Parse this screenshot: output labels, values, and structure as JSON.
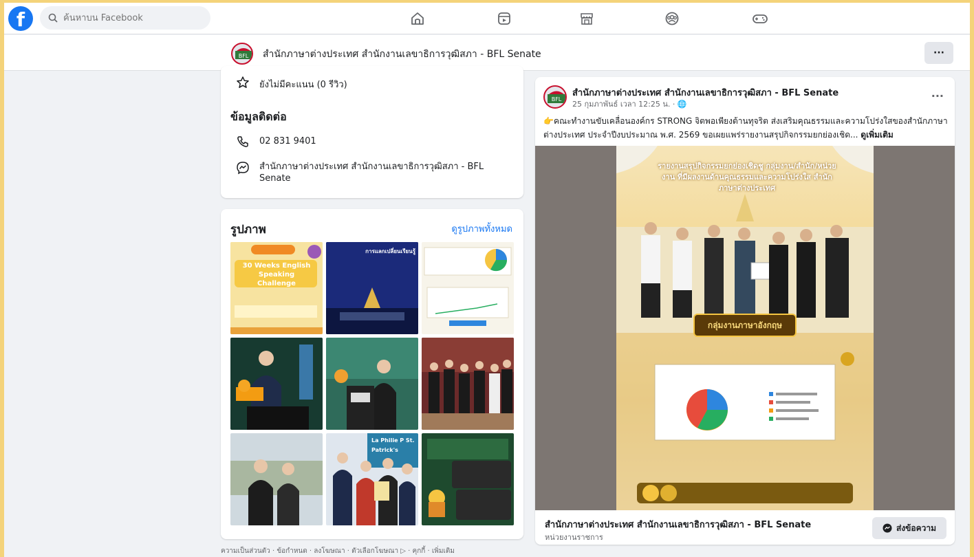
{
  "search": {
    "placeholder": "ค้นหาบน Facebook"
  },
  "nav": {
    "icons": [
      "home-icon",
      "video-icon",
      "marketplace-icon",
      "groups-icon",
      "gaming-icon"
    ]
  },
  "page_header": {
    "title": "สำนักภาษาต่างประเทศ สำนักงานเลขาธิการวุฒิสภา - BFL Senate",
    "more_label": "···"
  },
  "info": {
    "rating_text": "ยังไม่มีคะแนน (0 รีวิว)",
    "contact_title": "ข้อมูลติดต่อ",
    "phone": "02 831 9401",
    "messenger_name": "สำนักภาษาต่างประเทศ สำนักงานเลขาธิการวุฒิสภา - BFL Senate"
  },
  "photos": {
    "title": "รูปภาพ",
    "see_all": "ดูรูปภาพทั้งหมด",
    "tiles": [
      {
        "caption": "30 Weeks English Speaking Challenge",
        "bg": "#f7e3a0"
      },
      {
        "caption": "การแลกเปลี่ยนเรียนรู้",
        "bg": "#1b2a7a"
      },
      {
        "caption": "",
        "bg": "#f7f4ea"
      },
      {
        "caption": "",
        "bg": "#1f4b3a"
      },
      {
        "caption": "",
        "bg": "#2f6b5a"
      },
      {
        "caption": "",
        "bg": "#6b2a2a"
      },
      {
        "caption": "",
        "bg": "#cfd9df"
      },
      {
        "caption": "La Philie P St. Patrick's",
        "bg": "#dfe6ee"
      },
      {
        "caption": "",
        "bg": "#1e4a2e"
      }
    ]
  },
  "footer": {
    "links": "ความเป็นส่วนตัว · ข้อกำหนด · ลงโฆษณา · ตัวเลือกโฆษณา ▷ · คุกกี้ · เพิ่มเติม"
  },
  "post": {
    "author": "สำนักภาษาต่างประเทศ สำนักงานเลขาธิการวุฒิสภา - BFL Senate",
    "time": "25 กุมภาพันธ์ เวลา 12:25 น. · 🌐",
    "text": "👉คณะทำงานขับเคลื่อนองค์กร STRONG จิตพอเพียงต้านทุจริต ส่งเสริมคุณธรรมและความโปร่งใสของสำนักภาษาต่างประเทศ ประจำปีงบประมาณ พ.ศ. 2569 ขอเผยแพร่รายงานสรุปกิจกรรมยกย่องเชิด...",
    "see_more": "ดูเพิ่มเติม",
    "poster_title": "รายงานสรุปกิจกรรมยกย่องเชิดชู กลุ่มงาน/สำนัก/หน่วยงาน ที่มีผลงานด้านคุณธรรมและความโปร่งใส สำนักภาษาต่างประเทศ",
    "poster_banner": "กลุ่มงานภาษาอังกฤษ",
    "bottom_name": "สำนักภาษาต่างประเทศ สำนักงานเลขาธิการวุฒิสภา - BFL Senate",
    "bottom_sub": "หน่วยงานราชการ",
    "message_button": "ส่งข้อความ"
  },
  "colors": {
    "brand": "#1877f2",
    "page_bg": "#f0f2f5",
    "outer_bg": "#f4d37a"
  }
}
